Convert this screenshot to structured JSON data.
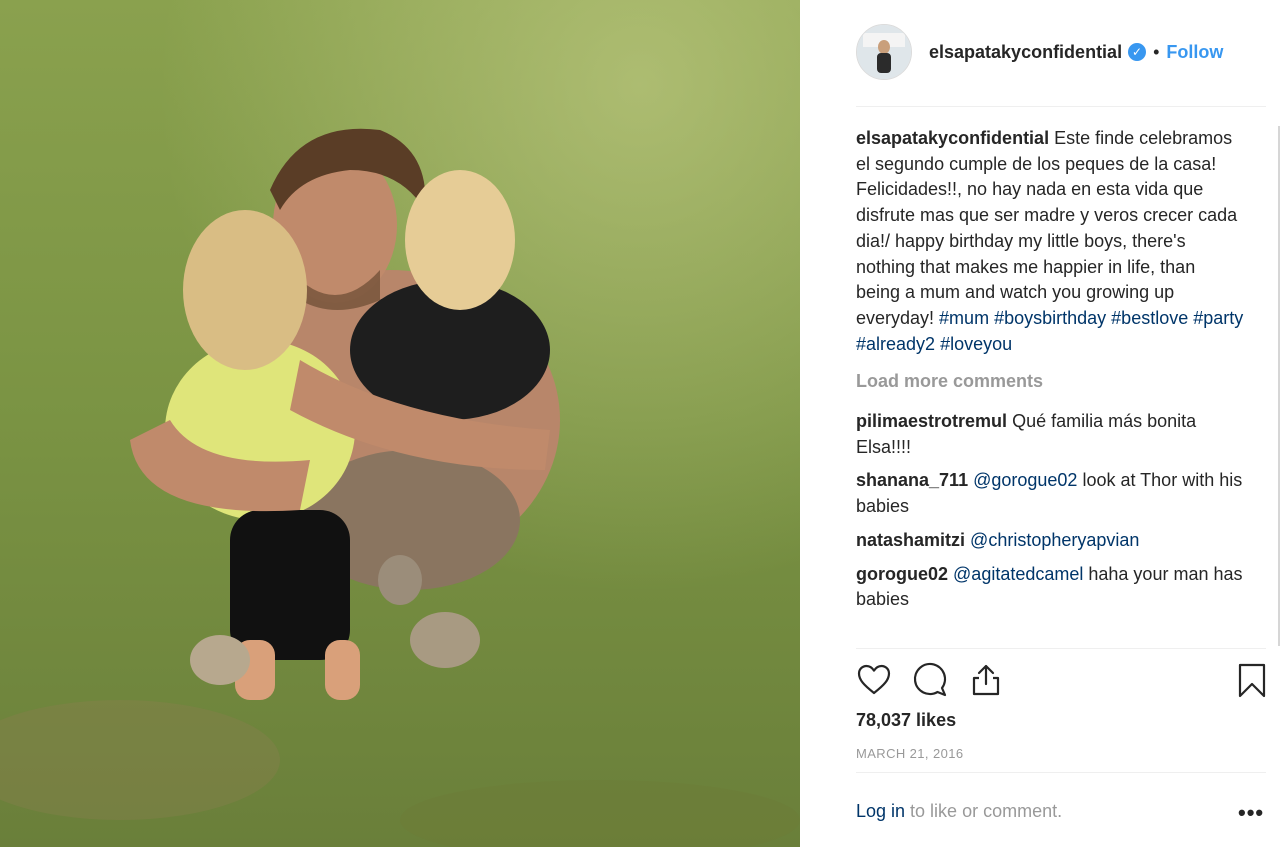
{
  "post": {
    "username": "elsapatakyconfidential",
    "follow_label": "Follow",
    "separator": "•",
    "caption_text": " Este finde celebramos el segundo cumple de los peques de la casa! Felicidades!!, no hay nada en esta vida que disfrute mas que ser madre y veros crecer cada dia!/ happy birthday my little boys, there's nothing that makes me happier in life, than being a mum and watch you growing up everyday! ",
    "hashtags": [
      "#mum",
      "#boysbirthday",
      "#bestlove",
      "#party",
      "#already2",
      "#loveyou"
    ],
    "load_more": "Load more comments",
    "comments": [
      {
        "user": "pilimaestrotremul",
        "mention": "",
        "text": "Qué familia más bonita Elsa!!!!"
      },
      {
        "user": "shanana_711",
        "mention": "@gorogue02",
        "text": "look at Thor with his babies"
      },
      {
        "user": "natashamitzi",
        "mention": "@christopheryapvian",
        "text": ""
      },
      {
        "user": "gorogue02",
        "mention": "@agitatedcamel",
        "text": "haha your man has babies"
      }
    ],
    "likes": "78,037 likes",
    "date": "MARCH 21, 2016",
    "login_link": "Log in",
    "login_rest": " to like or comment.",
    "more_label": "•••"
  },
  "colors": {
    "accent": "#3897f0",
    "link": "#003569",
    "muted": "#999999",
    "text": "#262626"
  },
  "icons": {
    "like": "heart-icon",
    "comment": "comment-bubble-icon",
    "share": "share-upload-icon",
    "save": "bookmark-icon",
    "verified": "verified-badge-icon"
  }
}
